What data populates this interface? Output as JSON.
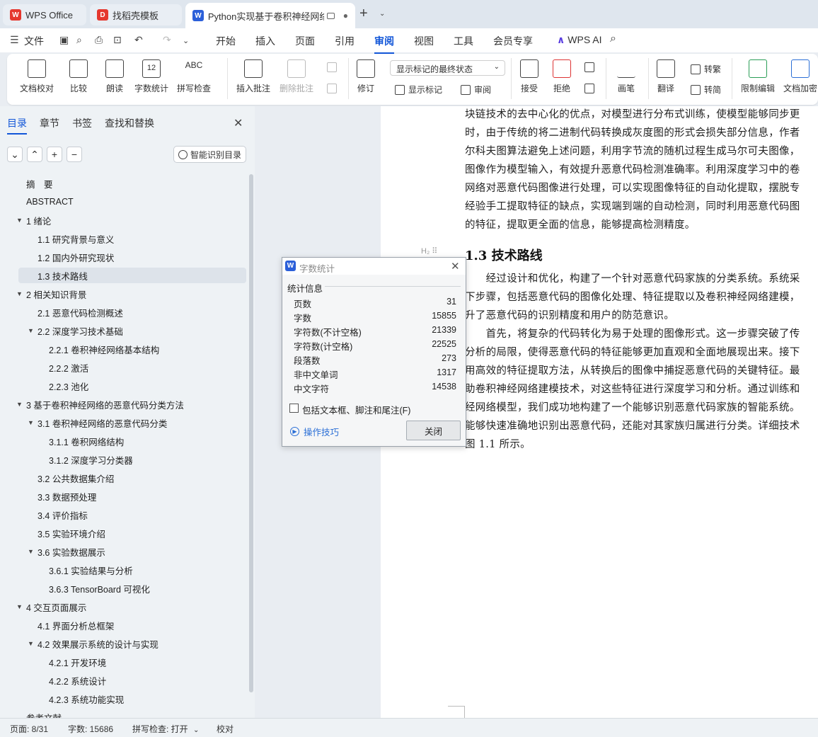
{
  "tabs": [
    {
      "label": "WPS Office",
      "icon": "wps-logo-icon",
      "color": "#e5372e"
    },
    {
      "label": "找稻壳模板",
      "icon": "docer-logo-icon",
      "color": "#e5372e"
    },
    {
      "label": "Python实现基于卷积神经网络",
      "icon": "writer-logo-icon",
      "color": "#2b5fd9",
      "status": "●"
    }
  ],
  "menu": {
    "file": "文件",
    "items": [
      "开始",
      "插入",
      "页面",
      "引用",
      "审阅",
      "视图",
      "工具",
      "会员专享"
    ],
    "active": "审阅",
    "ai": "WPS AI"
  },
  "ribbon": {
    "doc_check": "文档校对",
    "compare": "比较",
    "read_aloud": "朗读",
    "word_count": "字数统计",
    "word_count_icon_text": "12",
    "spell_check": "拼写检查",
    "spell_icon_text": "ABC",
    "insert_comment": "插入批注",
    "delete_comment": "删除批注",
    "track": "修订",
    "display_select": "显示标记的最终状态",
    "show_markup": "显示标记",
    "review": "审阅",
    "accept": "接受",
    "reject": "拒绝",
    "pen": "画笔",
    "translate": "翻译",
    "to_traditional": "转繁",
    "to_simplified": "转简",
    "restrict_edit": "限制编辑",
    "doc_encrypt": "文档加密"
  },
  "sidebar": {
    "tabs": [
      "目录",
      "章节",
      "书签",
      "查找和替换"
    ],
    "active_tab": "目录",
    "smart_button": "智能识别目录",
    "toc": [
      {
        "label": "摘　要",
        "level": 0,
        "arrow": ""
      },
      {
        "label": "ABSTRACT",
        "level": 0,
        "arrow": ""
      },
      {
        "label": "1  绪论",
        "level": 0,
        "arrow": "▼"
      },
      {
        "label": "1.1  研究背景与意义",
        "level": 1,
        "arrow": ""
      },
      {
        "label": "1.2  国内外研究现状",
        "level": 1,
        "arrow": ""
      },
      {
        "label": "1.3  技术路线",
        "level": 1,
        "arrow": "",
        "selected": true
      },
      {
        "label": "2  相关知识背景",
        "level": 0,
        "arrow": "▼"
      },
      {
        "label": "2.1  恶意代码检测概述",
        "level": 1,
        "arrow": ""
      },
      {
        "label": "2.2  深度学习技术基础",
        "level": 1,
        "arrow": "▼"
      },
      {
        "label": "2.2.1 卷积神经网络基本结构",
        "level": 2,
        "arrow": ""
      },
      {
        "label": "2.2.2 激活",
        "level": 2,
        "arrow": ""
      },
      {
        "label": "2.2.3 池化",
        "level": 2,
        "arrow": ""
      },
      {
        "label": "3  基于卷积神经网络的恶意代码分类方法",
        "level": 0,
        "arrow": "▼"
      },
      {
        "label": "3.1  卷积神经网络的恶意代码分类",
        "level": 1,
        "arrow": "▼"
      },
      {
        "label": "3.1.1  卷积网络结构",
        "level": 2,
        "arrow": ""
      },
      {
        "label": "3.1.2  深度学习分类器",
        "level": 2,
        "arrow": ""
      },
      {
        "label": "3.2 公共数据集介绍",
        "level": 1,
        "arrow": ""
      },
      {
        "label": "3.3 数据预处理",
        "level": 1,
        "arrow": ""
      },
      {
        "label": "3.4  评价指标",
        "level": 1,
        "arrow": ""
      },
      {
        "label": "3.5  实验环境介绍",
        "level": 1,
        "arrow": ""
      },
      {
        "label": "3.6  实验数据展示",
        "level": 1,
        "arrow": "▼"
      },
      {
        "label": "3.6.1  实验结果与分析",
        "level": 2,
        "arrow": ""
      },
      {
        "label": "3.6.3 TensorBoard 可视化",
        "level": 2,
        "arrow": ""
      },
      {
        "label": "4  交互页面展示",
        "level": 0,
        "arrow": "▼"
      },
      {
        "label": "4.1  界面分析总框架",
        "level": 1,
        "arrow": ""
      },
      {
        "label": "4.2  效果展示系统的设计与实现",
        "level": 1,
        "arrow": "▼"
      },
      {
        "label": "4.2.1  开发环境",
        "level": 2,
        "arrow": ""
      },
      {
        "label": "4.2.2  系统设计",
        "level": 2,
        "arrow": ""
      },
      {
        "label": "4.2.3  系统功能实现",
        "level": 2,
        "arrow": ""
      },
      {
        "label": "参考文献",
        "level": 0,
        "arrow": ""
      }
    ]
  },
  "document": {
    "para1": [
      "块链技术的去中心化的优点，对模型进行分布式训练，使模型能够同步更",
      "时，由于传统的将二进制代码转换成灰度图的形式会损失部分信息，作者",
      "尔科夫图算法避免上述问题，利用字节流的随机过程生成马尔可夫图像，",
      "图像作为模型输入，有效提升恶意代码检测准确率。利用深度学习中的卷",
      "网络对恶意代码图像进行处理，可以实现图像特征的自动化提取，摆脱专",
      "经验手工提取特征的缺点，实现端到端的自动检测，同时利用恶意代码图",
      "的特征，提取更全面的信息，能够提高检测精度。"
    ],
    "heading": "1.3  技术路线",
    "heading_marker": "H₂ ⠿",
    "para2": [
      "　　经过设计和优化，构建了一个针对恶意代码家族的分类系统。系统采",
      "下步骤，包括恶意代码的图像化处理、特征提取以及卷积神经网络建模，",
      "升了恶意代码的识别精度和用户的防范意识。",
      "　　首先，将复杂的代码转化为易于处理的图像形式。这一步骤突破了传",
      "分析的局限，使得恶意代码的特征能够更加直观和全面地展现出来。接下",
      "用高效的特征提取方法，从转换后的图像中捕捉恶意代码的关键特征。最",
      "助卷积神经网络建模技术，对这些特征进行深度学习和分析。通过训练和",
      "经网络模型，我们成功地构建了一个能够识别恶意代码家族的智能系统。",
      "能够快速准确地识别出恶意代码，还能对其家族归属进行分类。详细技术",
      "图 1.1 所示。"
    ]
  },
  "dialog": {
    "title": "字数统计",
    "section": "统计信息",
    "stats": [
      {
        "label": "页数",
        "value": "31"
      },
      {
        "label": "字数",
        "value": "15855"
      },
      {
        "label": "字符数(不计空格)",
        "value": "21339"
      },
      {
        "label": "字符数(计空格)",
        "value": "22525"
      },
      {
        "label": "段落数",
        "value": "273"
      },
      {
        "label": "非中文单词",
        "value": "1317"
      },
      {
        "label": "中文字符",
        "value": "14538"
      }
    ],
    "checkbox_label": "包括文本框、脚注和尾注(F)",
    "tips": "操作技巧",
    "close": "关闭"
  },
  "status": {
    "page": "页面: 8/31",
    "words": "字数: 15686",
    "spell": "拼写检查: 打开",
    "proof": "校对"
  }
}
